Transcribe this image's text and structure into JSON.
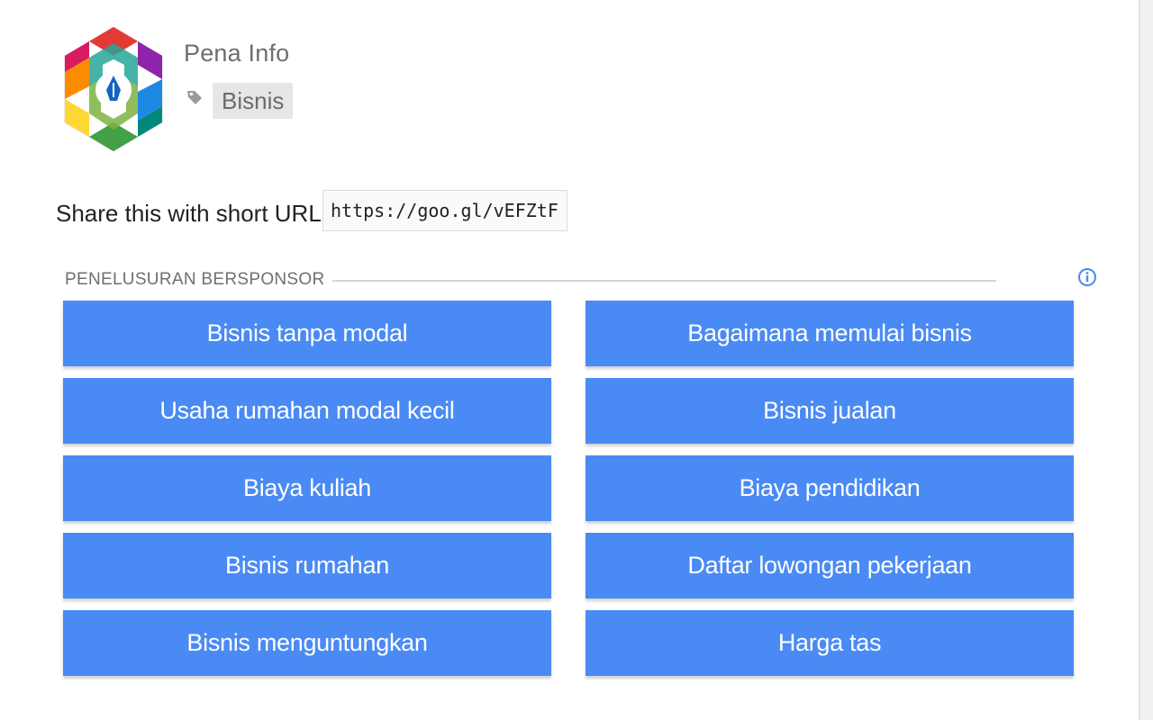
{
  "author": {
    "name": "Pena Info",
    "logo_icon": "pena-info-logo-icon",
    "tag_icon": "tag-icon",
    "tag": "Bisnis"
  },
  "share": {
    "label": "Share this with short URL:",
    "url": "https://goo.gl/vEFZtF"
  },
  "sponsored": {
    "heading": "PENELUSURAN BERSPONSOR",
    "info_icon": "info-icon",
    "accent_color": "#4a8af4",
    "items": [
      {
        "label": "Bisnis tanpa modal"
      },
      {
        "label": "Bagaimana memulai bisnis"
      },
      {
        "label": "Usaha rumahan modal kecil"
      },
      {
        "label": "Bisnis jualan"
      },
      {
        "label": "Biaya kuliah"
      },
      {
        "label": "Biaya pendidikan"
      },
      {
        "label": "Bisnis rumahan"
      },
      {
        "label": "Daftar lowongan pekerjaan"
      },
      {
        "label": "Bisnis menguntungkan"
      },
      {
        "label": "Harga tas"
      }
    ]
  }
}
